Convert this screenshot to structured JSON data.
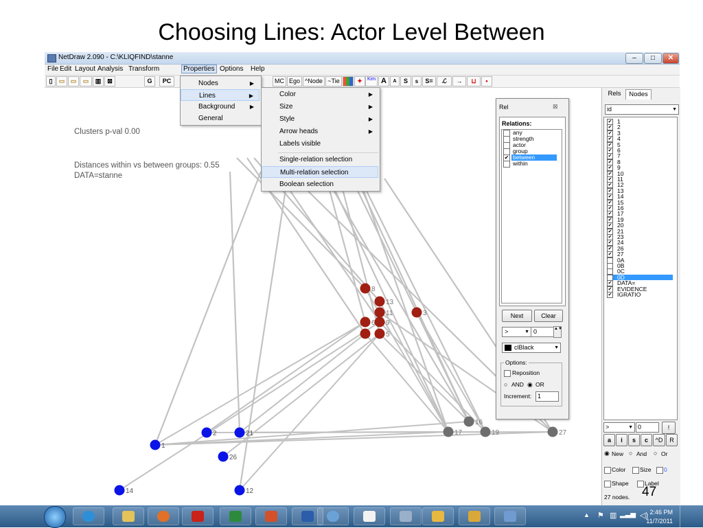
{
  "slide": {
    "title": "Choosing Lines: Actor Level Between",
    "page_number": "47"
  },
  "window": {
    "title": "NetDraw 2.090 - C:\\KLIQFIND\\stanne",
    "controls": [
      "–",
      "□",
      "✕"
    ]
  },
  "menubar": [
    "File",
    "Edit",
    "Layout",
    "Analysis",
    "Transform",
    "Properties",
    "Options",
    "Help"
  ],
  "toolbar": [
    "G",
    "PC",
    "MC",
    "Ego",
    "^Node",
    "~Tie",
    "Kim",
    "A",
    "A",
    "S",
    "s",
    "S="
  ],
  "properties_menu": [
    {
      "label": "Nodes",
      "has_sub": true
    },
    {
      "label": "Lines",
      "has_sub": true
    },
    {
      "label": "Background",
      "has_sub": true
    },
    {
      "label": "General",
      "has_sub": false
    }
  ],
  "lines_menu": [
    {
      "label": "Color",
      "has_sub": true
    },
    {
      "label": "Size",
      "has_sub": true
    },
    {
      "label": "Style",
      "has_sub": true
    },
    {
      "label": "Arrow heads",
      "has_sub": true
    },
    {
      "label": "Labels visible",
      "has_sub": false
    },
    {
      "label": "Single-relation selection",
      "has_sub": false
    },
    {
      "label": "Multi-relation selection",
      "has_sub": false
    },
    {
      "label": "Boolean selection",
      "has_sub": false
    }
  ],
  "canvas_info": {
    "clusters": "Clusters p-val   0.00",
    "distances": "Distances within vs between groups:   0.55",
    "data": "DATA=stanne"
  },
  "graph": {
    "colors": {
      "blue": "#0a14e6",
      "red": "#a01e12",
      "gray": "#6e6e6e",
      "edge": "#c2c2c2"
    },
    "nodes": [
      {
        "id": "8",
        "group": "red"
      },
      {
        "id": "13",
        "group": "red"
      },
      {
        "id": "11",
        "group": "red"
      },
      {
        "id": "3",
        "group": "red"
      },
      {
        "id": "9",
        "group": "red"
      },
      {
        "id": "5",
        "group": "red"
      },
      {
        "id": "6",
        "group": "red"
      },
      {
        "id": "1",
        "group": "blue"
      },
      {
        "id": "2",
        "group": "blue"
      },
      {
        "id": "21",
        "group": "blue"
      },
      {
        "id": "26",
        "group": "blue"
      },
      {
        "id": "14",
        "group": "blue"
      },
      {
        "id": "12",
        "group": "blue"
      },
      {
        "id": "16",
        "group": "gray"
      },
      {
        "id": "17",
        "group": "gray"
      },
      {
        "id": "19",
        "group": "gray"
      },
      {
        "id": "27",
        "group": "gray"
      }
    ]
  },
  "rel_dialog": {
    "title": "Rel",
    "close": "⊠",
    "heading": "Relations:",
    "relations": [
      {
        "label": "any",
        "checked": false,
        "selected": false
      },
      {
        "label": "strength",
        "checked": false,
        "selected": false
      },
      {
        "label": "actor",
        "checked": false,
        "selected": false
      },
      {
        "label": "group",
        "checked": false,
        "selected": false
      },
      {
        "label": "between",
        "checked": true,
        "selected": true
      },
      {
        "label": "within",
        "checked": false,
        "selected": false
      }
    ],
    "next": "Next",
    "clear": "Clear",
    "operator": ">",
    "threshold": "0",
    "color": "clBlack",
    "options_label": "Options:",
    "reposition": "Reposition",
    "and": "AND",
    "or": "OR",
    "increment_label": "Increment:",
    "increment": "1"
  },
  "right_panel": {
    "tabs": [
      "Rels",
      "Nodes"
    ],
    "attribute": "id",
    "items": [
      {
        "label": "1",
        "checked": true
      },
      {
        "label": "2",
        "checked": true
      },
      {
        "label": "3",
        "checked": true
      },
      {
        "label": "4",
        "checked": true
      },
      {
        "label": "5",
        "checked": true
      },
      {
        "label": "6",
        "checked": true
      },
      {
        "label": "7",
        "checked": true
      },
      {
        "label": "8",
        "checked": true
      },
      {
        "label": "9",
        "checked": true
      },
      {
        "label": "10",
        "checked": true
      },
      {
        "label": "11",
        "checked": true
      },
      {
        "label": "12",
        "checked": true
      },
      {
        "label": "13",
        "checked": true
      },
      {
        "label": "14",
        "checked": true
      },
      {
        "label": "15",
        "checked": true
      },
      {
        "label": "16",
        "checked": true
      },
      {
        "label": "17",
        "checked": true
      },
      {
        "label": "19",
        "checked": true
      },
      {
        "label": "20",
        "checked": true
      },
      {
        "label": "21",
        "checked": true
      },
      {
        "label": "23",
        "checked": true
      },
      {
        "label": "24",
        "checked": true
      },
      {
        "label": "26",
        "checked": true
      },
      {
        "label": "27",
        "checked": true
      },
      {
        "label": "0A",
        "checked": false
      },
      {
        "label": "0B",
        "checked": false
      },
      {
        "label": "0C",
        "checked": false
      },
      {
        "label": "0D",
        "checked": false,
        "selected": true
      },
      {
        "label": "DATA=",
        "checked": true
      },
      {
        "label": "EVIDENCE",
        "checked": true
      },
      {
        "label": "IGRATIO",
        "checked": true
      }
    ],
    "operator": ">",
    "value": "0",
    "go": "!",
    "buttons": [
      "a",
      "i",
      "s",
      "c",
      "^D",
      "R"
    ],
    "new": "New",
    "and": "And",
    "or": "Or",
    "color": "Color",
    "size": "Size",
    "size_value": "0",
    "shape": "Shape",
    "label": "Label",
    "status": "27 nodes."
  },
  "taskbar": {
    "time": "2:46 PM",
    "date": "11/7/2011"
  }
}
